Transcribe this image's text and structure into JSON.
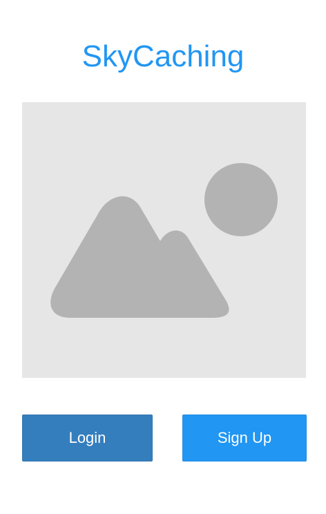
{
  "app": {
    "title": "SkyCaching"
  },
  "hero": {
    "icon": "image-placeholder-icon"
  },
  "actions": {
    "login_label": "Login",
    "signup_label": "Sign Up"
  },
  "colors": {
    "title": "#2196f3",
    "login_button": "#357ebd",
    "signup_button": "#2196f3",
    "placeholder_background": "#e6e6e6",
    "placeholder_shapes": "#b3b3b3"
  }
}
